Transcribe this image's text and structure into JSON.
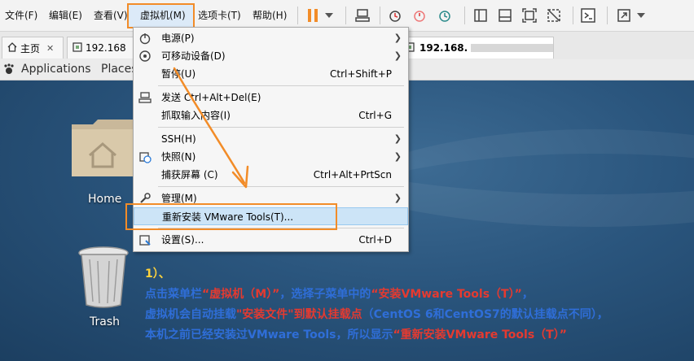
{
  "menubar": {
    "items": [
      "文件(F)",
      "编辑(E)",
      "查看(V)",
      "虚拟机(M)",
      "选项卡(T)",
      "帮助(H)"
    ]
  },
  "tabs": [
    {
      "label": "主页"
    },
    {
      "label": "192.168"
    },
    {
      "label": "192.168."
    }
  ],
  "panel": {
    "applications": "Applications",
    "places": "Places"
  },
  "desktop": {
    "home_label": "Home",
    "trash_label": "Trash"
  },
  "vm_menu": {
    "items": [
      {
        "label": "电源(P)",
        "shortcut": "",
        "submenu": true,
        "icon": "power-icon"
      },
      {
        "label": "可移动设备(D)",
        "shortcut": "",
        "submenu": true,
        "icon": "usb-icon"
      },
      {
        "label": "暂停(U)",
        "shortcut": "Ctrl+Shift+P",
        "submenu": false,
        "icon": ""
      },
      {
        "label": "发送 Ctrl+Alt+Del(E)",
        "shortcut": "",
        "submenu": false,
        "icon": "keyboard-icon"
      },
      {
        "label": "抓取输入内容(I)",
        "shortcut": "Ctrl+G",
        "submenu": false,
        "icon": ""
      },
      {
        "label": "SSH(H)",
        "shortcut": "",
        "submenu": true,
        "icon": ""
      },
      {
        "label": "快照(N)",
        "shortcut": "",
        "submenu": true,
        "icon": "snapshot-icon"
      },
      {
        "label": "捕获屏幕 (C)",
        "shortcut": "Ctrl+Alt+PrtScn",
        "submenu": false,
        "icon": ""
      },
      {
        "label": "管理(M)",
        "shortcut": "",
        "submenu": true,
        "icon": "wrench-icon"
      },
      {
        "label": "重新安装 VMware Tools(T)...",
        "shortcut": "",
        "submenu": false,
        "icon": ""
      },
      {
        "label": "设置(S)...",
        "shortcut": "Ctrl+D",
        "submenu": false,
        "icon": "settings-icon"
      }
    ]
  },
  "annotation": {
    "step": "1）、",
    "line1": {
      "a": "点击菜单栏",
      "b": "“虚拟机（M）”",
      "c": "，选择子菜单中的",
      "d": "“安装VMware Tools（T）”",
      "e": "，"
    },
    "line2": {
      "a": "虚拟机会自动挂载",
      "b": "\"安装文件\"到默认挂载点",
      "c": "（CentOS 6和CentOS7的默认挂载点不同），"
    },
    "line3": {
      "a": "本机之前已经安装过VMware Tools，所以显示",
      "b": "“重新安装VMware Tools（T）”"
    }
  },
  "colors": {
    "highlight": "#f28c28",
    "red_text": "#e53a30",
    "blue_text": "#2f6ed8",
    "yellow_text": "#ffd23c"
  }
}
